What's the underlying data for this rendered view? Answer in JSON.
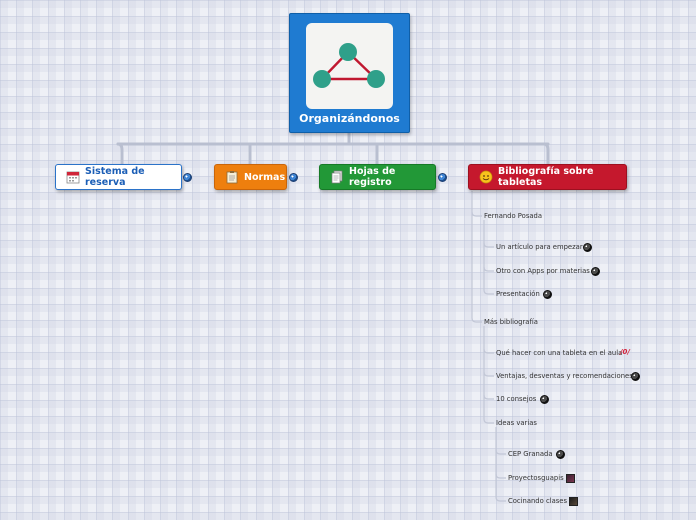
{
  "central": {
    "label": "Organizándonos"
  },
  "topics": [
    {
      "label": "Sistema de reserva"
    },
    {
      "label": "Normas"
    },
    {
      "label": "Hojas de registro"
    },
    {
      "label": "Bibliografía sobre tabletas"
    }
  ],
  "bibliografia": {
    "group1": {
      "label": "Fernando Posada",
      "items": [
        "Un artículo para empezar",
        "Otro con Apps por materias",
        "Presentación"
      ]
    },
    "group2": {
      "label": "Más bibliografía",
      "items": [
        "Qué hacer con una tableta en el aula",
        "Ventajas, desventas y recomendaciones",
        "10 consejos",
        "Ideas varias"
      ],
      "link_glyph": "/0/"
    },
    "group3": {
      "items": [
        "CEP Granada",
        "Proyectosguapis",
        "Cocinando clases"
      ]
    }
  },
  "colors": {
    "central": "#1f7bd1",
    "sistema": "#2b73c9",
    "normas": "#ee7f0e",
    "hojas": "#229837",
    "bibliografia": "#c5182d"
  }
}
